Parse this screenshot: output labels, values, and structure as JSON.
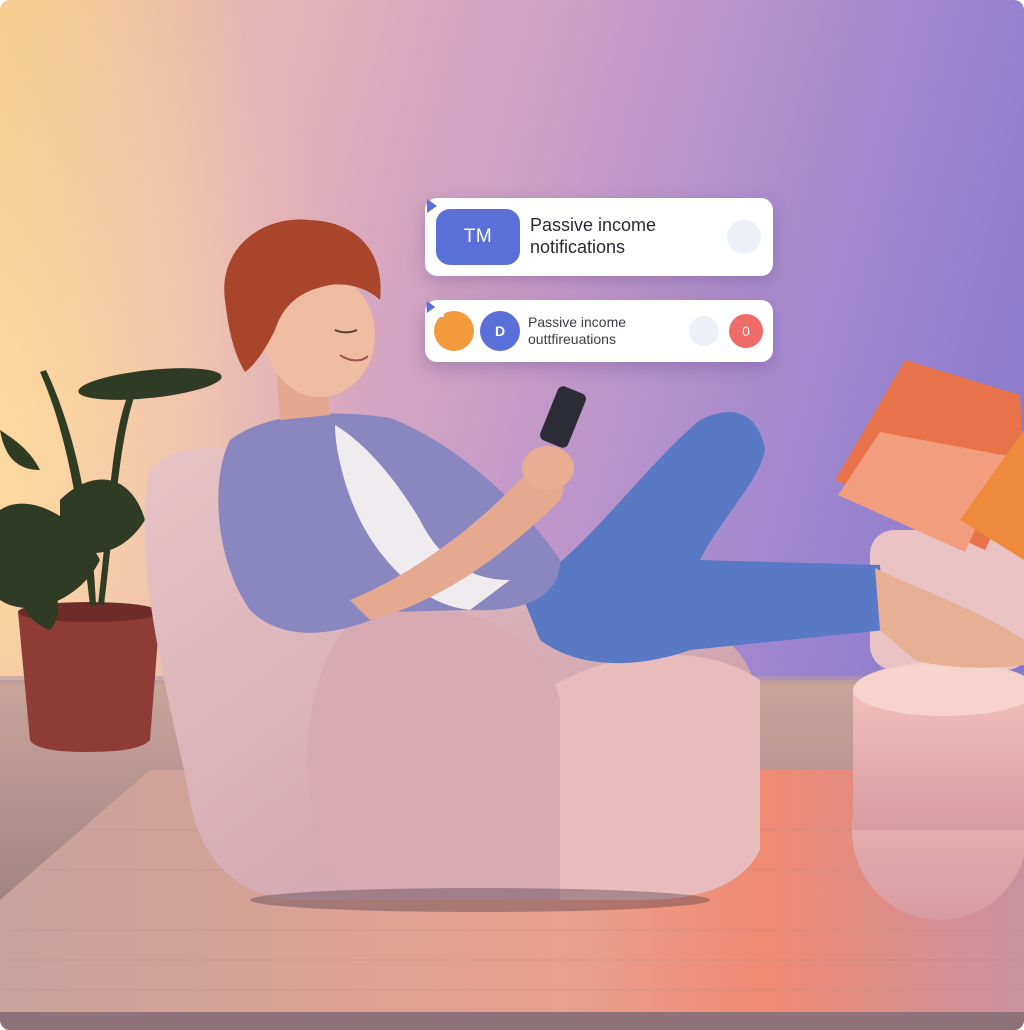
{
  "notifications": [
    {
      "badge_text": "TM",
      "title_line1": "Passive income",
      "title_line2": "notifications",
      "action_icon": "play-icon"
    },
    {
      "icon_left": "upload-icon",
      "icon_right_text": "D",
      "title_line1": "Passive income",
      "title_line2": "outtfireuations",
      "action_icon": "play-icon",
      "count": "0"
    }
  ],
  "colors": {
    "accent_blue": "#5b6fd8",
    "accent_orange": "#f39a3c",
    "badge_red": "#ef6b68",
    "card_bg": "#ffffff"
  }
}
